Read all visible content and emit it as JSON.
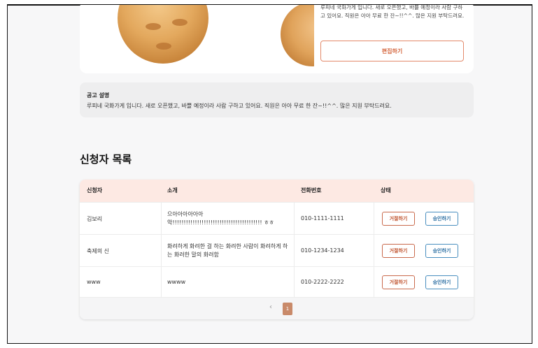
{
  "product": {
    "description": "루피네 국화가게 입니다. 새로 오픈했고, 바쁠 예정이라 사람 구하고 있어요. 직원은 아아 무료 한 잔~!!^^. 많은 지원 부탁드려요.",
    "edit_label": "편집하기"
  },
  "notice": {
    "title": "공고 설명",
    "body": "루피네 국화가게 입니다. 새로 오픈했고, 바쁠 예정이라 사람 구하고 있어요. 직원은 아아 무료 한 잔~!!^^. 많은 지원 부탁드려요."
  },
  "applicants": {
    "title": "신청자 목록",
    "columns": [
      "신청자",
      "소개",
      "전화번호",
      "상태"
    ],
    "rows": [
      {
        "name": "김보리",
        "intro": "으아아아아아아악!!!!!!!!!!!!!!!!!!!!!!!!!!!!!!!!!!!!!!!! ㅎㅎ",
        "phone": "010-1111-1111"
      },
      {
        "name": "축제의 신",
        "intro": "화려하게 화려한 걸 하는 화려한 사람이 화려하게 하는 화려한 말의 화려함",
        "phone": "010-1234-1234"
      },
      {
        "name": "www",
        "intro": "wwww",
        "phone": "010-2222-2222"
      }
    ],
    "reject_label": "거절하기",
    "approve_label": "승인하기"
  },
  "pagination": {
    "prev": "‹",
    "current": "1"
  }
}
